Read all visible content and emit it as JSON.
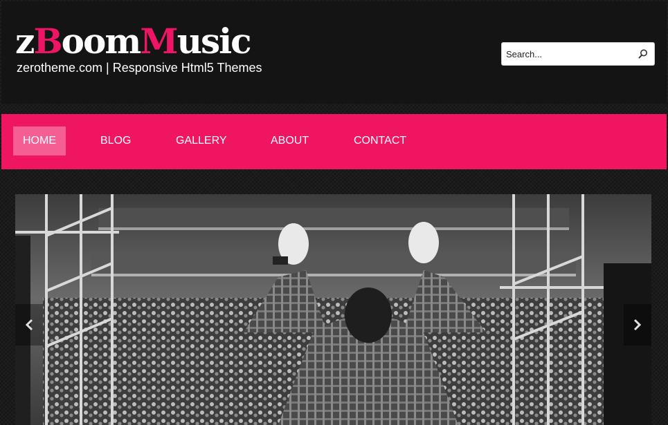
{
  "header": {
    "logo_parts": [
      "z",
      "B",
      "oom",
      "M",
      "usic"
    ],
    "tagline": "zerotheme.com | Responsive Html5 Themes"
  },
  "search": {
    "placeholder": "Search...",
    "icon": "search-icon"
  },
  "nav": {
    "items": [
      {
        "label": "HOME",
        "active": true
      },
      {
        "label": "BLOG",
        "active": false
      },
      {
        "label": "GALLERY",
        "active": false
      },
      {
        "label": "ABOUT",
        "active": false
      },
      {
        "label": "CONTACT",
        "active": false
      }
    ]
  },
  "slider": {
    "image": "concert-photo",
    "prev_icon": "chevron-left-icon",
    "next_icon": "chevron-right-icon"
  },
  "colors": {
    "accent": "#ef1560",
    "active_nav": "#f55e92",
    "header_bg": "#141414"
  }
}
